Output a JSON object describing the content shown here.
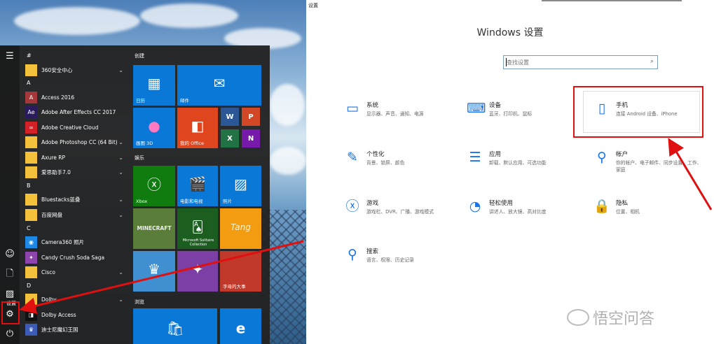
{
  "left": {
    "rail_label": "设置",
    "apps": [
      {
        "letter": "#"
      },
      {
        "name": "360安全中心",
        "icon": "folder-icon",
        "color": "#f4c13d",
        "chevron": true
      },
      {
        "letter": "A"
      },
      {
        "name": "Access 2016",
        "icon": "access-icon",
        "color": "#a4373a"
      },
      {
        "name": "Adobe After Effects CC 2017",
        "icon": "after-effects-icon",
        "color": "#2a1a5e",
        "glyph": "Ae"
      },
      {
        "name": "Adobe Creative Cloud",
        "icon": "creative-cloud-icon",
        "color": "#d42027"
      },
      {
        "name": "Adobe Photoshop CC (64 Bit)",
        "icon": "folder-icon",
        "color": "#f4c13d",
        "chevron": true
      },
      {
        "name": "Axure RP",
        "icon": "folder-icon",
        "color": "#f4c13d",
        "chevron": true
      },
      {
        "name": "爱思助手7.0",
        "icon": "folder-icon",
        "color": "#f4c13d",
        "chevron": true
      },
      {
        "letter": "B"
      },
      {
        "name": "Bluestacks蓝叠",
        "icon": "folder-icon",
        "color": "#f4c13d",
        "chevron": true
      },
      {
        "name": "百度网盘",
        "icon": "folder-icon",
        "color": "#f4c13d",
        "chevron": true
      },
      {
        "letter": "C"
      },
      {
        "name": "Camera360 照片",
        "icon": "camera360-icon",
        "color": "#1e88e5"
      },
      {
        "name": "Candy Crush Soda Saga",
        "icon": "candy-crush-icon",
        "color": "#8e44ad"
      },
      {
        "name": "Cisco",
        "icon": "folder-icon",
        "color": "#f4c13d",
        "chevron": true
      },
      {
        "letter": "D"
      },
      {
        "name": "Dolby",
        "icon": "folder-icon",
        "color": "#f4c13d",
        "chevron": true
      },
      {
        "name": "Dolby Access",
        "icon": "dolby-icon",
        "color": "#111111"
      },
      {
        "name": "迪士尼魔幻王国",
        "icon": "disney-icon",
        "color": "#3b5bb5"
      }
    ],
    "tiles": {
      "group1": "创建",
      "group2": "娱乐",
      "group3": "浏览",
      "calendar": "日历",
      "mail": "邮件",
      "paint3d": "画图 3D",
      "office": "我的 Office",
      "xbox": "Xbox",
      "movies": "电影和电视",
      "photos": "照片",
      "minecraft": "MINECRAFT",
      "solitaire": "Microsoft Solitaire Collection",
      "tang": "Tang",
      "game4": "字母的大事",
      "store_label": ""
    }
  },
  "right": {
    "window_title": "设置",
    "title": "Windows 设置",
    "search_placeholder": "查找设置",
    "categories": [
      {
        "name": "系统",
        "desc": "显示器、声音、通知、电源",
        "icon": "monitor-icon"
      },
      {
        "name": "设备",
        "desc": "蓝牙、打印机、鼠标",
        "icon": "devices-icon"
      },
      {
        "name": "手机",
        "desc": "连接 Android 设备、iPhone",
        "icon": "phone-icon"
      },
      {
        "name": "个性化",
        "desc": "背景、锁屏、颜色",
        "icon": "personalization-icon"
      },
      {
        "name": "应用",
        "desc": "卸载、默认应用、可选功能",
        "icon": "apps-icon"
      },
      {
        "name": "帐户",
        "desc": "你的帐户、电子邮件、同步设置、工作、家庭",
        "icon": "account-icon"
      },
      {
        "name": "游戏",
        "desc": "游戏栏、DVR、广播、游戏模式",
        "icon": "xbox-icon"
      },
      {
        "name": "轻松使用",
        "desc": "讲述人、放大镜、高对比度",
        "icon": "ease-of-access-icon"
      },
      {
        "name": "隐私",
        "desc": "位置、相机",
        "icon": "lock-icon"
      },
      {
        "name": "搜索",
        "desc": "语言、权限、历史记录",
        "icon": "search-icon"
      }
    ],
    "watermark": "悟空问答"
  },
  "colors": {
    "accent": "#1a73e8",
    "annotation_red": "#e01010",
    "start_bg": "#222222",
    "tile_blue": "#0a78d7"
  }
}
